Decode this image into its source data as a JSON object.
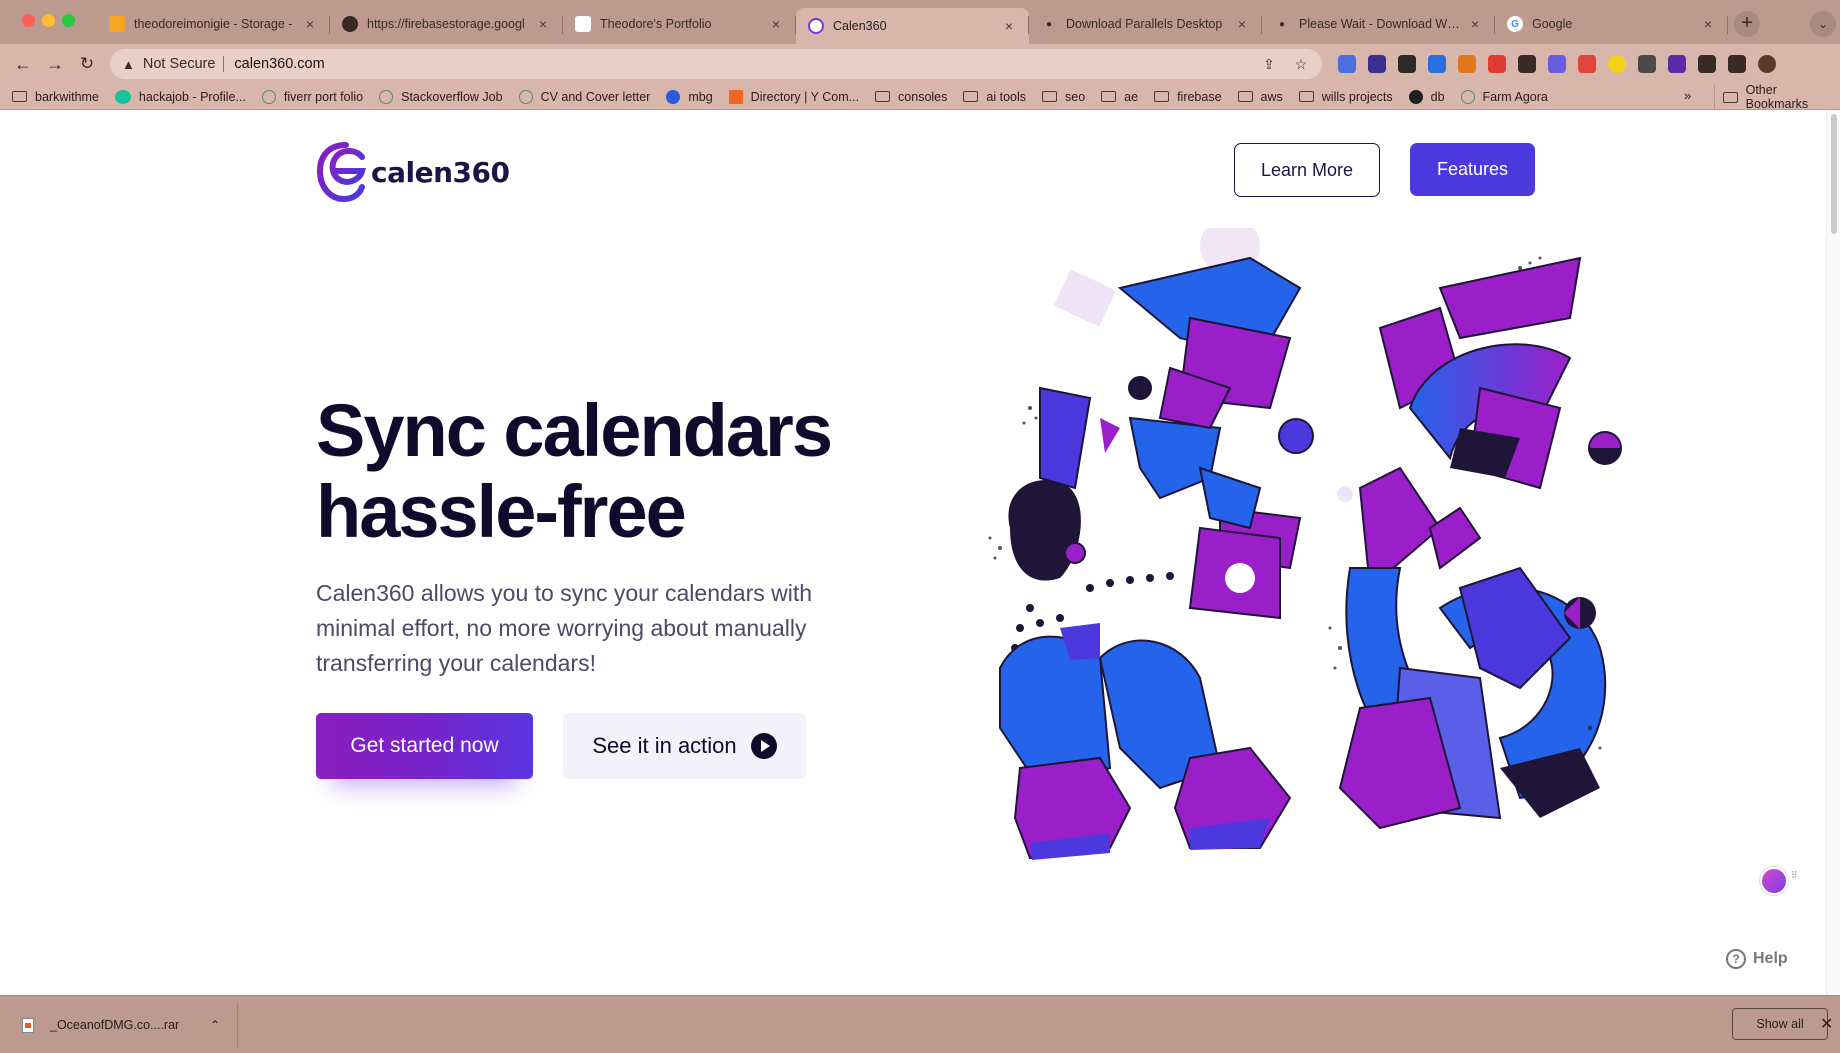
{
  "browser": {
    "tabs": [
      {
        "label": "theodoreimonigie - Storage -",
        "favicon": "firebase-icon",
        "color": "#f5a623",
        "active": false
      },
      {
        "label": "https://firebasestorage.googl",
        "favicon": "globe-icon",
        "color": "#3a2a25",
        "active": false
      },
      {
        "label": "Theodore's Portfolio",
        "favicon": "shield-icon",
        "color": "#ffffff",
        "active": false
      },
      {
        "label": "Calen360",
        "favicon": "calen360-icon",
        "color": "#6b3fe0",
        "active": true
      },
      {
        "label": "Download Parallels Desktop",
        "favicon": "apple-icon",
        "color": "#3a2a25",
        "active": false
      },
      {
        "label": "Please Wait - Download Will S",
        "favicon": "apple-icon",
        "color": "#3a2a25",
        "active": false
      },
      {
        "label": "Google",
        "favicon": "google-icon",
        "color": "#4285f4",
        "active": false
      }
    ],
    "new_tab_label": "+",
    "tab_search_label": "⌄",
    "omnibox": {
      "security_label": "Not Secure",
      "url": "calen360.com"
    },
    "extensions": [
      {
        "name": "translate-icon",
        "color": "#4a6fe0"
      },
      {
        "name": "badge-extension-icon",
        "color": "#3b2f8f"
      },
      {
        "name": "x-extension-icon",
        "color": "#2a2a2a"
      },
      {
        "name": "pen-extension-icon",
        "color": "#2a6fe0"
      },
      {
        "name": "metamask-icon",
        "color": "#e2761b"
      },
      {
        "name": "red-extension-icon",
        "color": "#e03c31"
      },
      {
        "name": "download-icon",
        "color": "#3a2a25"
      },
      {
        "name": "gear-extension-icon",
        "color": "#6a5de0"
      },
      {
        "name": "code-extension-icon",
        "color": "#e0453c"
      },
      {
        "name": "moon-extension-icon",
        "color": "#f3d21a"
      },
      {
        "name": "robot-extension-icon",
        "color": "#4a4a4a"
      },
      {
        "name": "purple-extension-icon",
        "color": "#5b2aa8"
      },
      {
        "name": "puzzle-icon",
        "color": "#3a2a25"
      },
      {
        "name": "sidepanel-icon",
        "color": "#3a2a25"
      },
      {
        "name": "profile-avatar",
        "color": "#5a3a2a"
      }
    ],
    "bookmarks": [
      {
        "label": "barkwithme",
        "icon": "folder"
      },
      {
        "label": "hackajob - Profile...",
        "icon": "hackajob"
      },
      {
        "label": "fiverr port folio",
        "icon": "chatgpt"
      },
      {
        "label": "Stackoverflow Job",
        "icon": "chatgpt"
      },
      {
        "label": "CV and Cover letter",
        "icon": "chatgpt"
      },
      {
        "label": "mbg",
        "icon": "mbg"
      },
      {
        "label": "Directory | Y Com...",
        "icon": "ycombinator"
      },
      {
        "label": "consoles",
        "icon": "folder"
      },
      {
        "label": "ai tools",
        "icon": "folder"
      },
      {
        "label": "seo",
        "icon": "folder"
      },
      {
        "label": "ae",
        "icon": "folder"
      },
      {
        "label": "firebase",
        "icon": "folder"
      },
      {
        "label": "aws",
        "icon": "folder"
      },
      {
        "label": "wills projects",
        "icon": "folder"
      },
      {
        "label": "db",
        "icon": "mongodb"
      },
      {
        "label": "Farm Agora",
        "icon": "chatgpt"
      }
    ],
    "bookmarks_more": "»",
    "other_bookmarks": "Other Bookmarks"
  },
  "page": {
    "logo_text": "calen360",
    "nav": {
      "learn_more": "Learn More",
      "features": "Features"
    },
    "hero": {
      "title": "Sync calendars hassle-free",
      "subtitle": "Calen360 allows you to sync your calendars with minimal effort, no more worrying about manually transferring your calendars!",
      "cta_primary": "Get started now",
      "cta_secondary": "See it in action"
    },
    "help_label": "Help"
  },
  "download_shelf": {
    "file_name": "_OceanofDMG.co....rar",
    "show_all": "Show all",
    "close": "✕"
  },
  "colors": {
    "brand_primary": "#4b39de",
    "brand_purple": "#8c1dbe",
    "hero_text": "#0e0b2d",
    "art_blue": "#2563eb",
    "art_purple": "#9b1fc9",
    "art_dark": "#1e1538"
  }
}
